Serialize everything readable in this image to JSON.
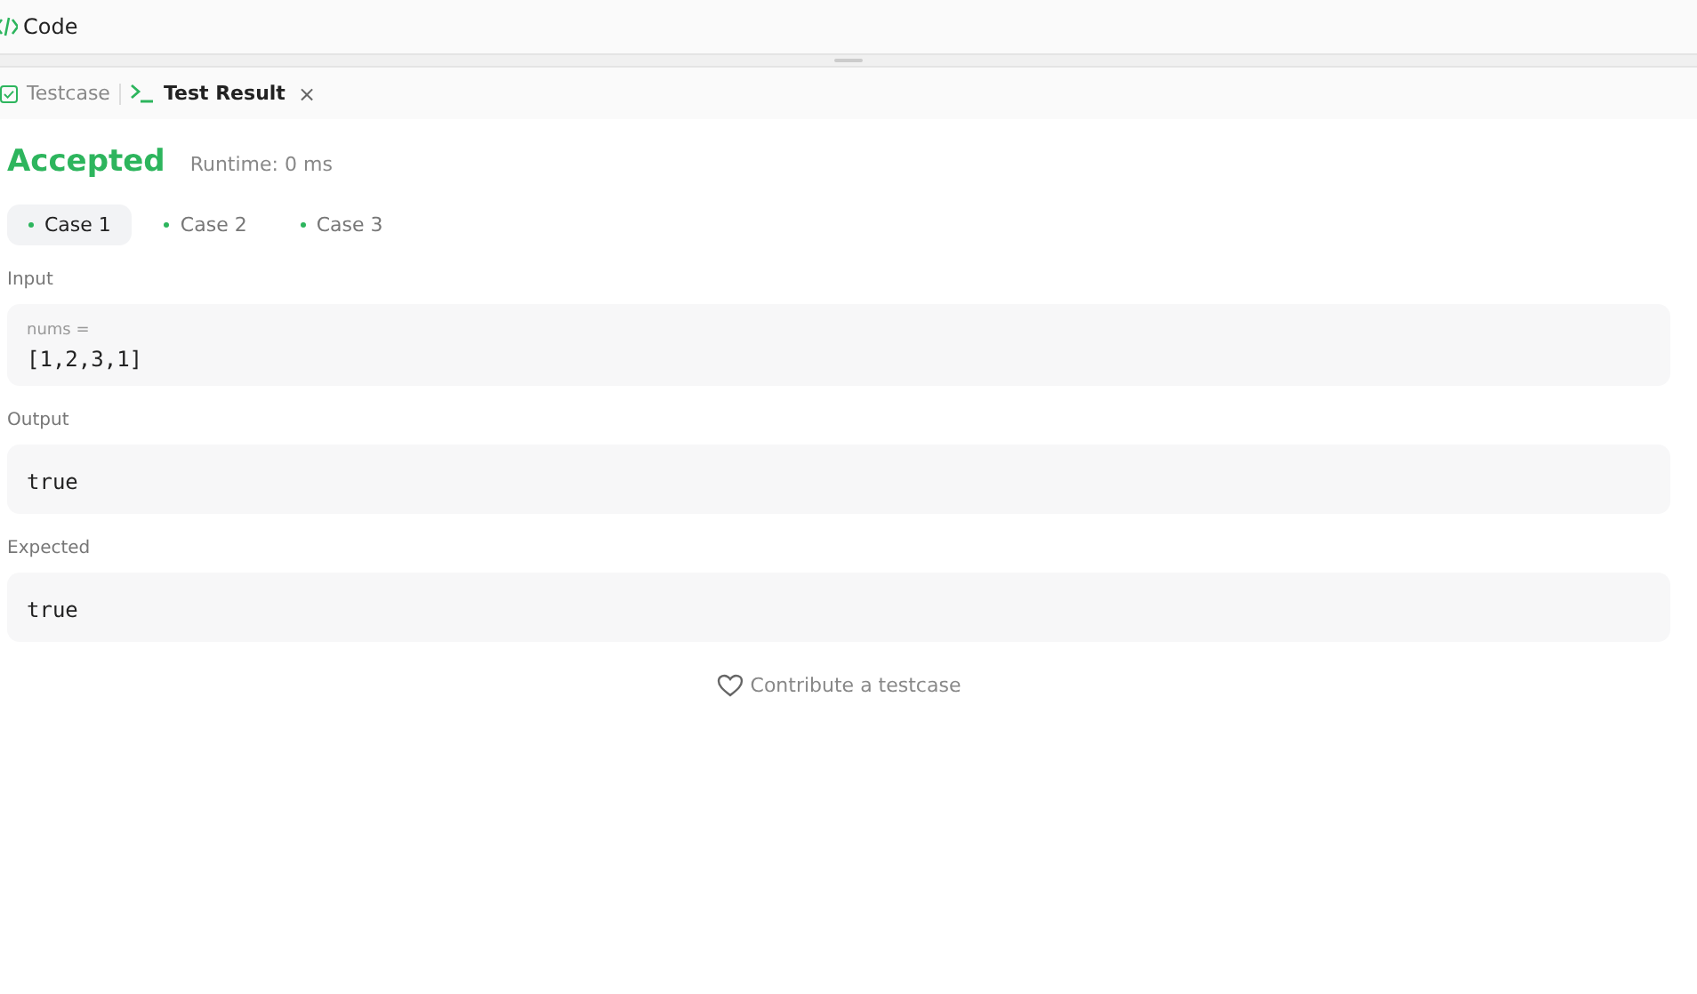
{
  "header": {
    "title": "Code"
  },
  "tabs": [
    {
      "label": "Testcase",
      "kind": "testcase",
      "selected": false
    },
    {
      "label": "Test Result",
      "kind": "result",
      "selected": true,
      "close": "×"
    }
  ],
  "result": {
    "status": "Accepted",
    "runtime": "Runtime: 0 ms"
  },
  "cases": [
    {
      "label": "Case 1",
      "selected": true
    },
    {
      "label": "Case 2",
      "selected": false
    },
    {
      "label": "Case 3",
      "selected": false
    }
  ],
  "input": {
    "label": "Input",
    "variables": [
      {
        "name": "nums =",
        "value": "[1,2,3,1]"
      }
    ]
  },
  "output": {
    "label": "Output",
    "value": "true"
  },
  "expected": {
    "label": "Expected",
    "value": "true"
  },
  "contribute": "Contribute a testcase"
}
